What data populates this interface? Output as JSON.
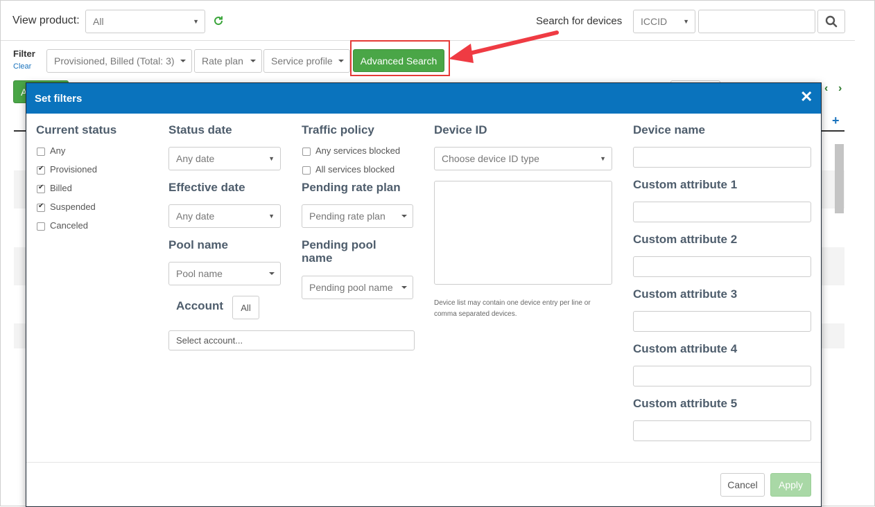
{
  "topbar": {
    "view_product_label": "View product:",
    "view_product_value": "All",
    "search_label": "Search for devices",
    "search_type": "ICCID",
    "search_value": ""
  },
  "filterbar": {
    "filter_label": "Filter",
    "clear_label": "Clear",
    "status_filter": "Provisioned, Billed (Total: 3)",
    "rate_plan": "Rate plan",
    "service_profile": "Service profile",
    "advanced_search": "Advanced Search"
  },
  "background": {
    "green_button_partial": "A"
  },
  "colors": {
    "modal_header": "#0a73bd",
    "advanced_button": "#4aa647",
    "apply_button": "#a9d8a6",
    "highlight_box": "#e53935",
    "arrow": "#ef3b43"
  },
  "modal": {
    "title": "Set filters",
    "current_status": {
      "heading": "Current status",
      "options": [
        {
          "label": "Any",
          "checked": false
        },
        {
          "label": "Provisioned",
          "checked": true
        },
        {
          "label": "Billed",
          "checked": true
        },
        {
          "label": "Suspended",
          "checked": true
        },
        {
          "label": "Canceled",
          "checked": false
        }
      ]
    },
    "status_date": {
      "heading": "Status date",
      "value": "Any date"
    },
    "effective_date": {
      "heading": "Effective date",
      "value": "Any date"
    },
    "pool_name": {
      "heading": "Pool name",
      "value": "Pool name"
    },
    "account": {
      "heading": "Account",
      "all_button": "All",
      "placeholder": "Select account..."
    },
    "traffic_policy": {
      "heading": "Traffic policy",
      "options": [
        {
          "label": "Any services blocked",
          "checked": false
        },
        {
          "label": "All services blocked",
          "checked": false
        }
      ]
    },
    "pending_rate_plan": {
      "heading": "Pending rate plan",
      "value": "Pending rate plan"
    },
    "pending_pool_name": {
      "heading_line1": "Pending pool",
      "heading_line2": "name",
      "value": "Pending pool name"
    },
    "device_id": {
      "heading": "Device ID",
      "type_placeholder": "Choose device ID type",
      "list_value": "",
      "hint_line1": "Device list may contain one device entry per line or",
      "hint_line2": "comma separated devices."
    },
    "device_name": {
      "heading": "Device name",
      "value": ""
    },
    "custom_attributes": [
      {
        "heading": "Custom attribute 1",
        "value": ""
      },
      {
        "heading": "Custom attribute 2",
        "value": ""
      },
      {
        "heading": "Custom attribute 3",
        "value": ""
      },
      {
        "heading": "Custom attribute 4",
        "value": ""
      },
      {
        "heading": "Custom attribute 5",
        "value": ""
      }
    ],
    "cancel_label": "Cancel",
    "apply_label": "Apply",
    "close_icon": "close-icon"
  }
}
